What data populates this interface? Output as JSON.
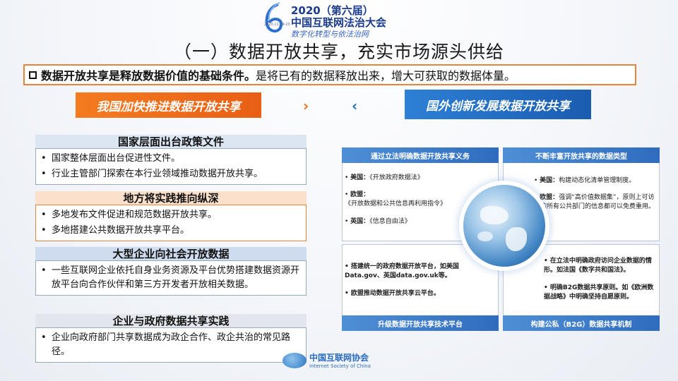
{
  "header": {
    "year_line": "2020（第六届）",
    "conference_name": "中国互联网法治大会",
    "theme": "数字化转型与依法治网",
    "date": "2020.11.19-20"
  },
  "title": "（一）数据开放共享，充实市场源头供给",
  "intro": {
    "bold": "数据开放共享是释放数据价值的基础条件。",
    "normal": "是将已有的数据释放出来，增大可获取的数据体量。"
  },
  "tags": {
    "left": "我国加快推进数据开放共享",
    "right": "国外创新发展数据开放共享",
    "chevron_right": "›",
    "chevron_left": "‹"
  },
  "left_sections": [
    {
      "heading": "国家层面出台政策文件",
      "items": [
        "国家整体层面出台促进性文件。",
        "行业主管部门探索在本行业领域推动数据开放共享。"
      ]
    },
    {
      "heading": "地方将实践推向纵深",
      "items": [
        "多地发布文件促进和规范数据开放共享。",
        "多地搭建公共数据开放共享平台。"
      ]
    },
    {
      "heading": "大型企业向社会开放数据",
      "items": [
        "一些互联网企业依托自身业务资源及平台优势搭建数据资源开放平台向合作伙伴和第三方开发者开放相关数据。"
      ]
    },
    {
      "heading": "企业与政府数据共享实践",
      "items": [
        "企业向政府部门共享数据成为政企合作、政企共治的常见路径。"
      ]
    }
  ],
  "bullet": "•",
  "right_panel": {
    "top_left": {
      "heading": "通过立法明确数据开放共享义务",
      "items": [
        {
          "label": "美国：",
          "text": "《开放政府数据法》"
        },
        {
          "label": "欧盟：",
          "text": "《开放数据和公共信息再利用指令》"
        },
        {
          "label": "英国：",
          "text": "《信息自由法》"
        }
      ]
    },
    "top_right": {
      "heading": "不断丰富开放共享的数据类型",
      "items": [
        {
          "label": "美国：",
          "text": "构建动态化清单管理制度。"
        },
        {
          "label": "欧盟：",
          "text": "强调“高价值数据集”，原则上可访问的所有公共部门的信息都可以免费重用。"
        }
      ]
    },
    "bottom_left": {
      "footer": "升级数据开放共享技术平台",
      "items": [
        {
          "label": "",
          "text": "搭建统一的政府数据开放平台，如美国Data.gov、英国data.gov.uk等。"
        },
        {
          "label": "",
          "text": "欧盟推动数据开放共享云平台。"
        }
      ]
    },
    "bottom_right": {
      "footer": "构建公私（B2G）数据共享机制",
      "items": [
        {
          "label": "",
          "text": "在立法中明确政府访问企业数据的情形。如法国《数字共和国法》。"
        },
        {
          "label": "",
          "text": "明确B2G数据共享原则。如《欧洲数据战略》中明确坚持自愿原则。"
        }
      ]
    }
  },
  "footer_logo": {
    "cn": "中国互联网协会",
    "en": "Internet Society of China"
  },
  "colors": {
    "orange": "#f47b20",
    "blue": "#1f6cc7",
    "header_blue": "#1b3c8c"
  }
}
